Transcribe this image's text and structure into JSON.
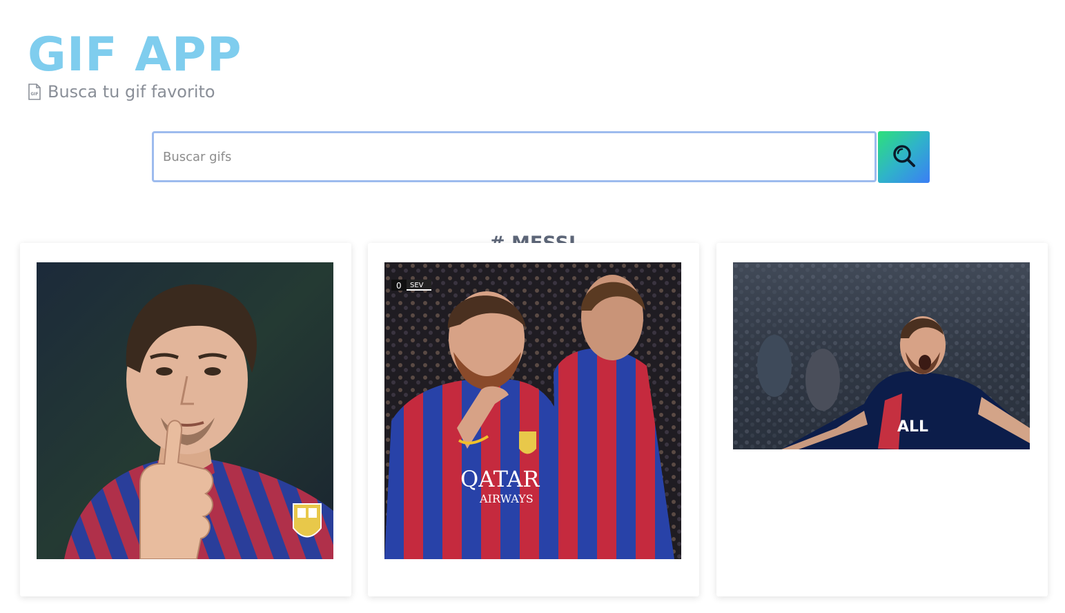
{
  "app": {
    "title": "GIF APP",
    "subtitle": "Busca tu gif favorito",
    "subtitle_icon": "gif-file-icon"
  },
  "search": {
    "placeholder": "Buscar gifs",
    "value": "",
    "button_icon": "search-icon",
    "gradient": [
      "#2ee07a",
      "#3b7ef5"
    ]
  },
  "category": {
    "heading": "# MESSI"
  },
  "gifs": [
    {
      "alt": "",
      "title": ""
    },
    {
      "alt": "",
      "title": "",
      "scoreboard": {
        "score": "0",
        "team": "SEV"
      },
      "jersey_sponsor": "QATAR",
      "jersey_sponsor_2": "AIRWAYS"
    },
    {
      "alt": "",
      "title": "",
      "jersey_sponsor": "ALL"
    }
  ],
  "colors": {
    "title": "#7fcdee",
    "input_border": "#9dbbee",
    "heading": "#5d6678"
  }
}
